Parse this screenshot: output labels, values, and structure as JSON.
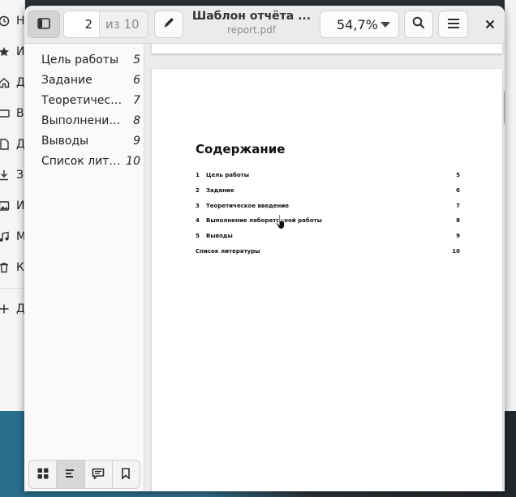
{
  "background_sidebar": {
    "items": [
      {
        "label": "Н",
        "icon": "clock-icon"
      },
      {
        "label": "И",
        "icon": "star-icon"
      },
      {
        "label": "Д",
        "icon": "home-icon"
      },
      {
        "label": "В",
        "icon": "desktop-icon"
      },
      {
        "label": "Д",
        "icon": "document-icon"
      },
      {
        "label": "З",
        "icon": "download-icon"
      },
      {
        "label": "И",
        "icon": "image-icon"
      },
      {
        "label": "М",
        "icon": "music-icon"
      },
      {
        "label": "К",
        "icon": "trash-icon"
      },
      {
        "label": "Д",
        "icon": "plus-icon"
      }
    ]
  },
  "header": {
    "page_current": "2",
    "page_total": "из 10",
    "title": "Шаблон отчёта ...",
    "filename": "report.pdf",
    "zoom": "54,7%"
  },
  "toc": [
    {
      "title": "Цель работы",
      "page": "5"
    },
    {
      "title": "Задание",
      "page": "6"
    },
    {
      "title": "Теоретичес…",
      "page": "7"
    },
    {
      "title": "Выполнение…",
      "page": "8"
    },
    {
      "title": "Выводы",
      "page": "9"
    },
    {
      "title": "Список лите…",
      "page": "10"
    }
  ],
  "pdf_page": {
    "heading": "Содержание",
    "entries": [
      {
        "num": "1",
        "text": "Цель работы",
        "page": "5"
      },
      {
        "num": "2",
        "text": "Задание",
        "page": "6"
      },
      {
        "num": "3",
        "text": "Теоретическое введение",
        "page": "7"
      },
      {
        "num": "4",
        "text": "Выполнение лабораторной работы",
        "page": "8"
      },
      {
        "num": "5",
        "text": "Выводы",
        "page": "9"
      },
      {
        "num": "",
        "text": "Список литературы",
        "page": "10"
      }
    ]
  },
  "colors": {
    "accent": "#ebebeb",
    "desktop": "#2a6f8e"
  }
}
